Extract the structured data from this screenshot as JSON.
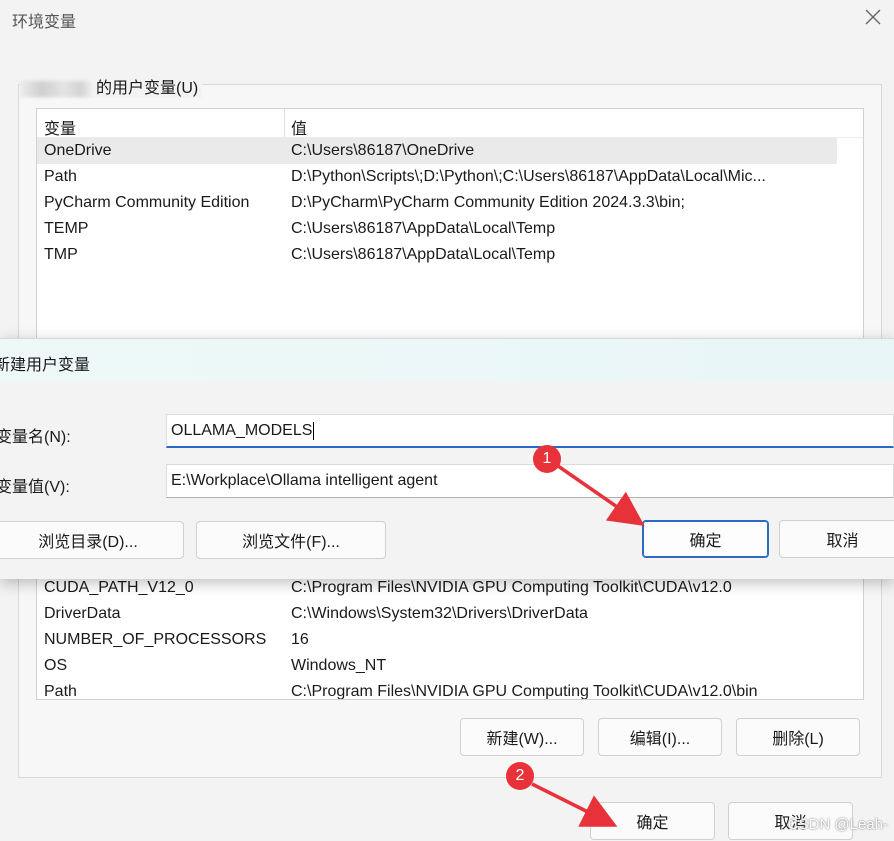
{
  "window": {
    "title": "环境变量"
  },
  "user_section": {
    "label_suffix": "的用户变量(U)"
  },
  "columns": {
    "variable": "变量",
    "value": "值"
  },
  "user_vars": [
    {
      "name": "OneDrive",
      "value": "C:\\Users\\86187\\OneDrive",
      "selected": true
    },
    {
      "name": "Path",
      "value": "D:\\Python\\Scripts\\;D:\\Python\\;C:\\Users\\86187\\AppData\\Local\\Mic..."
    },
    {
      "name": "PyCharm Community Edition",
      "value": "D:\\PyCharm\\PyCharm Community Edition 2024.3.3\\bin;"
    },
    {
      "name": "TEMP",
      "value": "C:\\Users\\86187\\AppData\\Local\\Temp"
    },
    {
      "name": "TMP",
      "value": "C:\\Users\\86187\\AppData\\Local\\Temp"
    }
  ],
  "sys_vars": [
    {
      "name": "CUDA_PATH_V12_0",
      "value": "C:\\Program Files\\NVIDIA GPU Computing Toolkit\\CUDA\\v12.0"
    },
    {
      "name": "DriverData",
      "value": "C:\\Windows\\System32\\Drivers\\DriverData"
    },
    {
      "name": "NUMBER_OF_PROCESSORS",
      "value": "16"
    },
    {
      "name": "OS",
      "value": "Windows_NT"
    },
    {
      "name": "Path",
      "value": "C:\\Program Files\\NVIDIA GPU Computing Toolkit\\CUDA\\v12.0\\bin"
    }
  ],
  "sys_buttons": {
    "new": "新建(W)...",
    "edit": "编辑(I)...",
    "delete": "删除(L)"
  },
  "footer_buttons": {
    "ok": "确定",
    "cancel": "取消"
  },
  "dialog": {
    "title": "新建用户变量",
    "name_label": "变量名(N):",
    "name_value": "OLLAMA_MODELS",
    "value_label": "变量值(V):",
    "value_value": "E:\\Workplace\\Ollama intelligent agent",
    "browse_dir": "浏览目录(D)...",
    "browse_file": "浏览文件(F)...",
    "ok": "确定",
    "cancel": "取消"
  },
  "annotations": {
    "badge1": "1",
    "badge2": "2",
    "accent": "#e8323a"
  },
  "watermark": "CSDN @Leah-"
}
